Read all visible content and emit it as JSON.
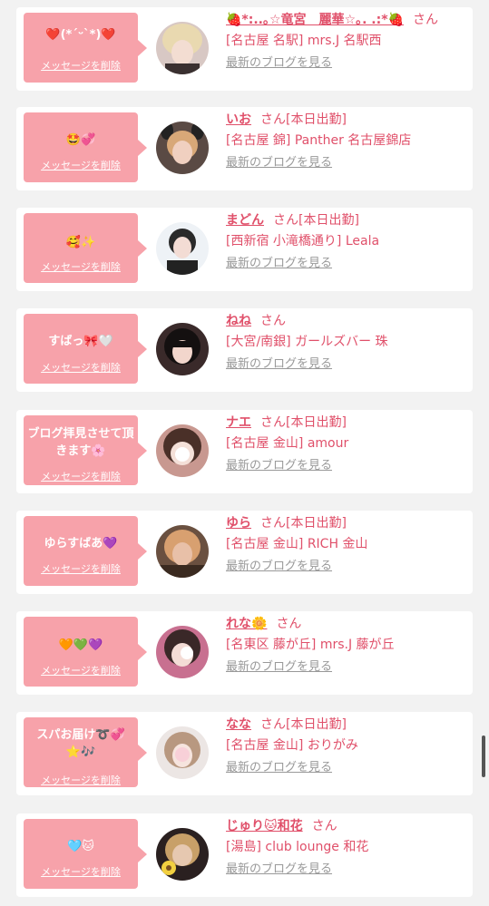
{
  "entries": [
    {
      "message": "❤️(*ˊᵕˋ*)❤️",
      "delete_label": "メッセージを削除",
      "name": "🍓*:..｡☆竜宮　麗華☆｡. .:*🍓",
      "honorific": "さん",
      "status": "",
      "store": "[名古屋 名駅] mrs.J 名駅西",
      "blog_link": "最新のブログを見る"
    },
    {
      "message": "🤩💞",
      "delete_label": "メッセージを削除",
      "name": "いお",
      "honorific": "さん",
      "status": "[本日出勤]",
      "store": "[名古屋 錦] Panther 名古屋錦店",
      "blog_link": "最新のブログを見る"
    },
    {
      "message": "🥰✨",
      "delete_label": "メッセージを削除",
      "name": "まどん",
      "honorific": "さん",
      "status": "[本日出勤]",
      "store": "[西新宿 小滝橋通り] Leala",
      "blog_link": "最新のブログを見る"
    },
    {
      "message": "すばっ🎀🤍",
      "delete_label": "メッセージを削除",
      "name": "ねね",
      "honorific": "さん",
      "status": "",
      "store": "[大宮/南銀] ガールズバー 珠",
      "blog_link": "最新のブログを見る"
    },
    {
      "message": "ブログ拝見させて頂きます🌸",
      "delete_label": "メッセージを削除",
      "name": "ナエ",
      "honorific": "さん",
      "status": "[本日出勤]",
      "store": "[名古屋 金山] amour",
      "blog_link": "最新のブログを見る"
    },
    {
      "message": "ゆらすばあ💜",
      "delete_label": "メッセージを削除",
      "name": "ゆら",
      "honorific": "さん",
      "status": "[本日出勤]",
      "store": "[名古屋 金山] RICH 金山",
      "blog_link": "最新のブログを見る"
    },
    {
      "message": "🧡💚💜",
      "delete_label": "メッセージを削除",
      "name": "れな🌼",
      "honorific": "さん",
      "status": "",
      "store": "[名東区 藤が丘] mrs.J 藤が丘",
      "blog_link": "最新のブログを見る"
    },
    {
      "message": "スパお届け➰💞⭐🎶",
      "delete_label": "メッセージを削除",
      "name": "なな",
      "honorific": "さん",
      "status": "[本日出勤]",
      "store": "[名古屋 金山] おりがみ",
      "blog_link": "最新のブログを見る"
    },
    {
      "message": "🩵🐱",
      "delete_label": "メッセージを削除",
      "name": "じゅり🐱和花",
      "honorific": "さん",
      "status": "",
      "store": "[湯島] club lounge 和花",
      "blog_link": "最新のブログを見る"
    }
  ]
}
